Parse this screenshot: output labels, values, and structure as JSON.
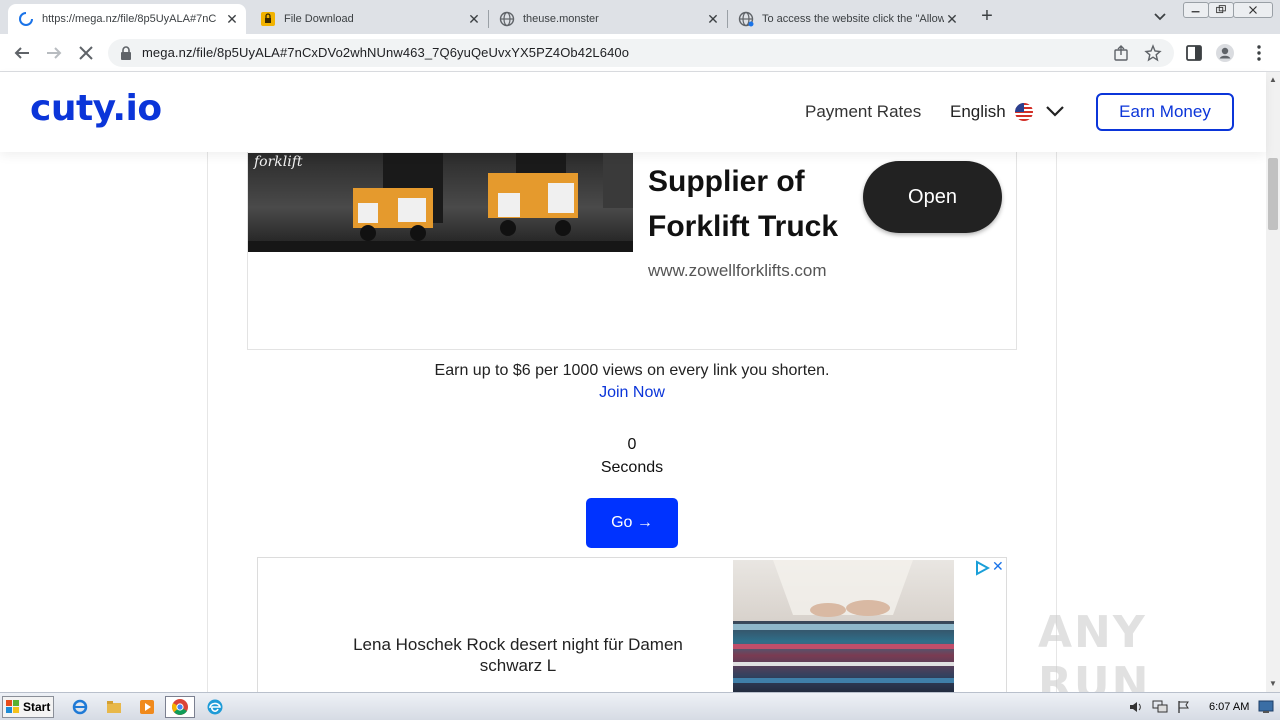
{
  "browser": {
    "tabs": [
      {
        "title": "https://mega.nz/file/8p5UyALA#7nC",
        "active": true
      },
      {
        "title": "File Download",
        "active": false
      },
      {
        "title": "theuse.monster",
        "active": false
      },
      {
        "title": "To access the website click the \"Allow",
        "active": false
      }
    ],
    "new_tab_symbol": "+",
    "close_symbol": "✕",
    "url": "mega.nz/file/8p5UyALA#7nCxDVo2whNUnw463_7Q6yuQeUvxYX5PZ4Ob42L640o"
  },
  "site": {
    "logo": "cuty.io",
    "nav": {
      "payment_rates": "Payment Rates",
      "language": "English",
      "earn_money": "Earn Money"
    },
    "ad_top": {
      "brand": "forklift",
      "title": "Supplier of Forklift Truck",
      "url": "www.zowellforklifts.com",
      "cta": "Open"
    },
    "earn_text": "Earn up to $6 per 1000 views on every link you shorten.",
    "join_link": "Join Now",
    "countdown": {
      "value": "0",
      "unit": "Seconds"
    },
    "go_button": "Go →",
    "ad_bottom": {
      "text": "Lena Hoschek Rock desert night für Damen schwarz L",
      "close": "✕"
    },
    "watermark": "ANY RUN"
  },
  "taskbar": {
    "start": "Start",
    "clock": "6:07 AM"
  },
  "colors": {
    "brand_blue": "#0b35d9",
    "go_button_blue": "#0033ff",
    "ad_cta_dark": "#222222"
  }
}
